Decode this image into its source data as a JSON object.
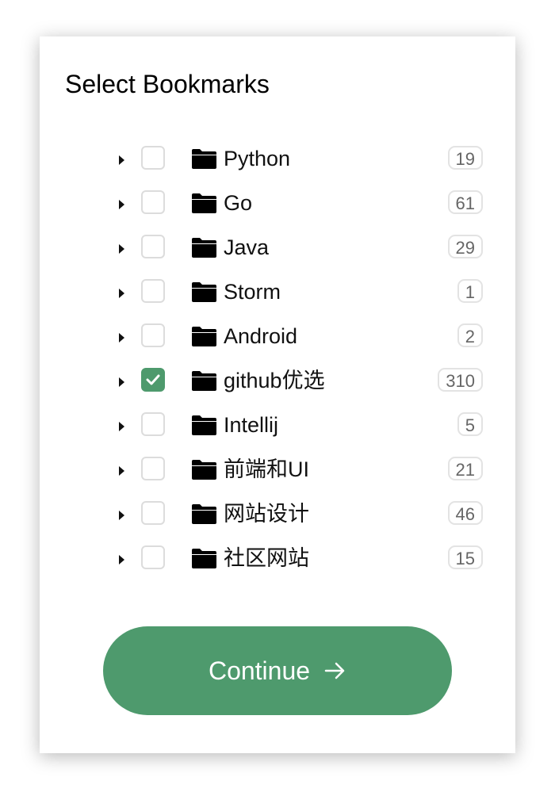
{
  "dialog": {
    "title": "Select Bookmarks"
  },
  "bookmarks": [
    {
      "label": "Python",
      "count": "19",
      "checked": false
    },
    {
      "label": "Go",
      "count": "61",
      "checked": false
    },
    {
      "label": "Java",
      "count": "29",
      "checked": false
    },
    {
      "label": "Storm",
      "count": "1",
      "checked": false
    },
    {
      "label": "Android",
      "count": "2",
      "checked": false
    },
    {
      "label": "github优选",
      "count": "310",
      "checked": true
    },
    {
      "label": "Intellij",
      "count": "5",
      "checked": false
    },
    {
      "label": "前端和UI",
      "count": "21",
      "checked": false
    },
    {
      "label": "网站设计",
      "count": "46",
      "checked": false
    },
    {
      "label": "社区网站",
      "count": "15",
      "checked": false
    }
  ],
  "actions": {
    "continue_label": "Continue"
  },
  "icons": {
    "expand": "caret-right-icon",
    "folder": "folder-icon",
    "check": "check-icon",
    "arrow": "arrow-right-icon"
  },
  "colors": {
    "accent": "#4e9a6d",
    "badge_border": "#e3e3e3",
    "checkbox_border": "#dcdcdc"
  }
}
